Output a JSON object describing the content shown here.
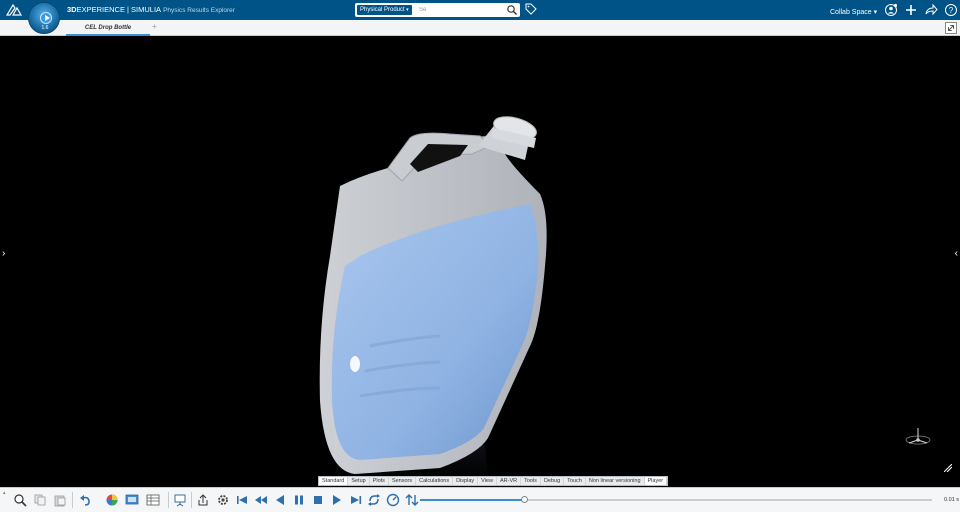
{
  "header": {
    "brand_prefix": "3D",
    "brand_main": "EXPERIENCE | SIMULIA",
    "app_name": "Physics Results Explorer",
    "compass_version": "1.6",
    "search_scope": "Physical Product",
    "search_value": "Se",
    "collab_space": "Collab Space",
    "icons": [
      "3ds-logo-icon",
      "compass-icon",
      "search-icon",
      "tag-icon",
      "user-icon",
      "add-icon",
      "share-icon",
      "help-icon"
    ]
  },
  "tabs": {
    "items": [
      {
        "label": "CEL Drop Bottle",
        "active": true
      }
    ],
    "add_label": "+"
  },
  "sections": [
    {
      "label": "Standard",
      "active": true
    },
    {
      "label": "Setup"
    },
    {
      "label": "Plots"
    },
    {
      "label": "Sensors"
    },
    {
      "label": "Calculations"
    },
    {
      "label": "Display"
    },
    {
      "label": "View"
    },
    {
      "label": "AR-VR"
    },
    {
      "label": "Tools"
    },
    {
      "label": "Debug"
    },
    {
      "label": "Touch"
    },
    {
      "label": "Non linear versioning"
    },
    {
      "label": "Player"
    }
  ],
  "player": {
    "time_label": "0.01 s",
    "progress": 0.205
  },
  "colors": {
    "topbar": "#005386",
    "accent": "#3b8fd1",
    "fluid": "#8fb3e3",
    "background": "#000000"
  }
}
